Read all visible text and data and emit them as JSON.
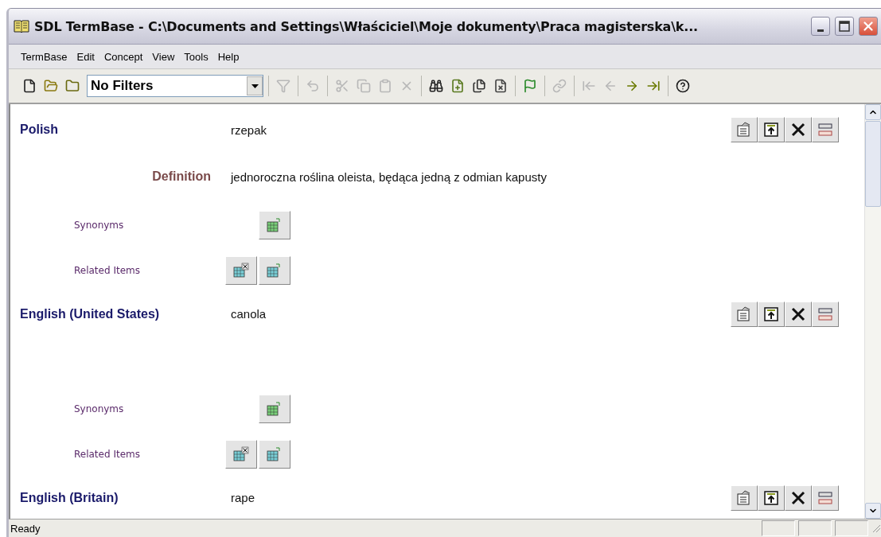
{
  "window": {
    "title": "SDL TermBase - C:\\Documents and Settings\\Właściciel\\Moje dokumenty\\Praca magisterska\\k..."
  },
  "menu": [
    "TermBase",
    "Edit",
    "Concept",
    "View",
    "Tools",
    "Help"
  ],
  "toolbar": {
    "filter": {
      "value": "No Filters"
    },
    "groups": [
      [
        {
          "disabled": false
        },
        {
          "disabled": false
        },
        {
          "disabled": false
        }
      ],
      [
        {
          "disabled": true
        }
      ],
      [
        {
          "disabled": true
        }
      ],
      [
        {
          "disabled": true
        },
        {
          "disabled": true
        },
        {
          "disabled": true
        },
        {
          "disabled": true
        }
      ],
      [
        {
          "disabled": false
        },
        {
          "disabled": false
        },
        {
          "disabled": false
        },
        {
          "disabled": false
        }
      ],
      [
        {
          "disabled": false
        }
      ],
      [
        {
          "disabled": true
        }
      ],
      [
        {
          "disabled": true
        },
        {
          "disabled": true
        },
        {
          "disabled": false
        },
        {
          "disabled": false
        }
      ],
      [
        {
          "disabled": false
        }
      ]
    ]
  },
  "entries": [
    {
      "language": "Polish",
      "term": "rzepak",
      "definition": {
        "label": "Definition",
        "value": "jednoroczna roślina oleista, będąca jedną z odmian kapusty"
      },
      "synonyms": "Synonyms",
      "related": "Related Items"
    },
    {
      "language": "English (United States)",
      "term": "canola",
      "synonyms": "Synonyms",
      "related": "Related Items"
    },
    {
      "language": "English (Britain)",
      "term": "rape"
    }
  ],
  "status_bar": {
    "text": "Ready"
  }
}
